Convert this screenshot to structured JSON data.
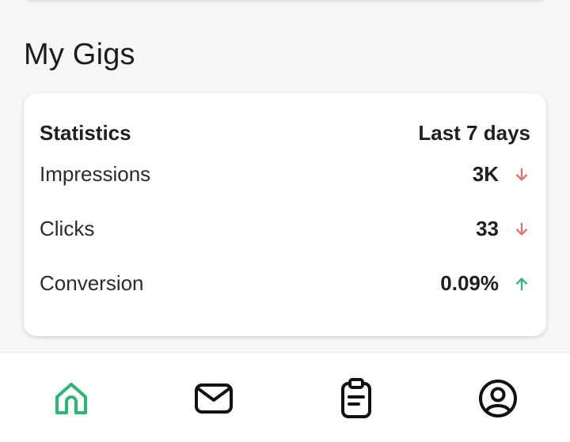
{
  "section": {
    "title": "My Gigs"
  },
  "statistics": {
    "title": "Statistics",
    "period": "Last 7 days",
    "rows": [
      {
        "label": "Impressions",
        "value": "3K",
        "trend": "down",
        "trend_icon": "arrow-down-icon"
      },
      {
        "label": "Clicks",
        "value": "33",
        "trend": "down",
        "trend_icon": "arrow-down-icon"
      },
      {
        "label": "Conversion",
        "value": "0.09%",
        "trend": "up",
        "trend_icon": "arrow-up-icon"
      }
    ]
  },
  "nav": {
    "items": [
      {
        "icon": "home-icon",
        "active": true
      },
      {
        "icon": "mail-icon",
        "active": false
      },
      {
        "icon": "clipboard-icon",
        "active": false
      },
      {
        "icon": "user-circle-icon",
        "active": false
      }
    ]
  },
  "colors": {
    "accent": "#2bb673",
    "trend_down": "#e06c6c",
    "trend_up": "#2bb673",
    "text": "#1f1f1f",
    "background": "#f7f7f7",
    "card": "#ffffff"
  }
}
